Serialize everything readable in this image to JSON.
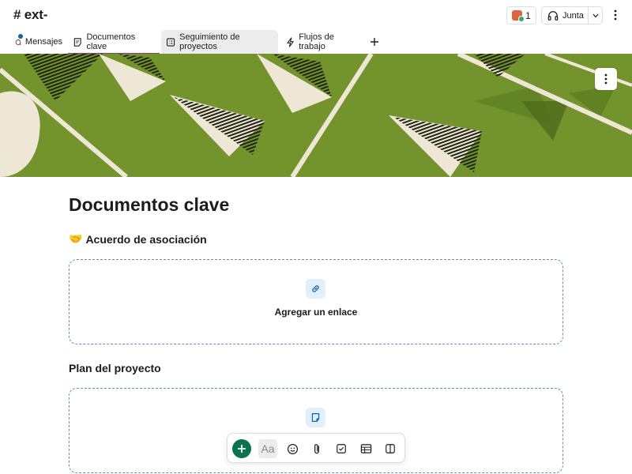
{
  "header": {
    "channel_title": "# ext-",
    "huddle_member_count": "1",
    "huddle_label": "Junta"
  },
  "tabs": [
    {
      "label": "Mensajes",
      "icon": "message-bubble-icon",
      "has_notification": true
    },
    {
      "label": "Documentos clave",
      "icon": "canvas-doc-icon",
      "active": true
    },
    {
      "label": "Seguimiento de proyectos",
      "icon": "list-tracker-icon",
      "hovered": true
    },
    {
      "label": "Flujos de trabajo",
      "icon": "lightning-icon"
    }
  ],
  "banner": {
    "style": "green paper airplanes illustration",
    "colors": {
      "green": "#6f8f2a",
      "cream": "#efe7d5",
      "dark": "#1f2414"
    }
  },
  "document": {
    "title": "Documentos clave",
    "sections": [
      {
        "emoji": "🤝",
        "heading": "Acuerdo de asociación",
        "placeholder_label": "Agregar un enlace",
        "placeholder_icon": "link-icon"
      },
      {
        "emoji": "",
        "heading": "Plan del proyecto",
        "placeholder_label": "",
        "placeholder_icon": "note-icon"
      }
    ]
  },
  "toolbar": {
    "format_label": "Aa",
    "buttons": [
      "add-button",
      "format-button",
      "emoji-button",
      "attach-button",
      "checklist-button",
      "table-button",
      "layout-button"
    ]
  },
  "colors": {
    "accent_purple": "#8d3a8a",
    "dashed_blue": "#5b93c6",
    "primary_green": "#0b7250",
    "notify_blue": "#1264a3"
  }
}
